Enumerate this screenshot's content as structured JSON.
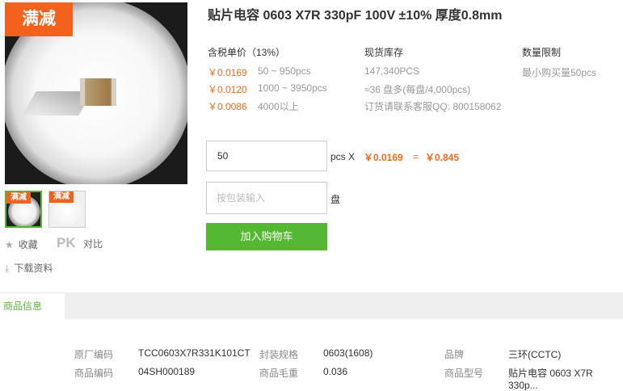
{
  "badge": {
    "main": "满减",
    "thumb": "满减"
  },
  "sidebar": {
    "favorite_label": "收藏",
    "pk_label": "PK",
    "compare_label": "对比",
    "download_label": "下载资料"
  },
  "product": {
    "title": "贴片电容 0603 X7R 330pF 100V ±10% 厚度0.8mm"
  },
  "pricing": {
    "header": "含税单价（13%）",
    "tiers": [
      {
        "price": "￥0.0169",
        "range": "50 ~ 950pcs"
      },
      {
        "price": "￥0.0120",
        "range": "1000 ~ 3950pcs"
      },
      {
        "price": "￥0.0086",
        "range": "4000以上"
      }
    ]
  },
  "stock": {
    "header": "现货库存",
    "quantity": "147,340PCS",
    "reels": "≈36 盘多(每盘/4,000pcs)",
    "contact": "订货请联系客服QQ: 800158062"
  },
  "limit": {
    "header": "数量限制",
    "min": "最小购买量50pcs"
  },
  "order": {
    "qty_value": "50",
    "unit_label": "pcs X",
    "unit_price": "￥0.0169",
    "equals": "=",
    "total": "￥0.845",
    "pack_placeholder": "按包装输入",
    "reel_label": "盘",
    "cart_label": "加入购物车"
  },
  "tabs": {
    "active": "商品信息"
  },
  "specs": {
    "row1": [
      {
        "k": "原厂编码",
        "v": "TCC0603X7R331K101CT"
      },
      {
        "k": "封装规格",
        "v": "0603(1608)"
      },
      {
        "k": "品牌",
        "v": "三环(CCTC)"
      }
    ],
    "row2": [
      {
        "k": "商品编码",
        "v": "04SH000189"
      },
      {
        "k": "商品毛重",
        "v": "0.036"
      },
      {
        "k": "商品型号",
        "v": "贴片电容 0603 X7R 330p..."
      }
    ]
  },
  "colors": {
    "accent": "#f2611d",
    "green": "#55b832"
  }
}
